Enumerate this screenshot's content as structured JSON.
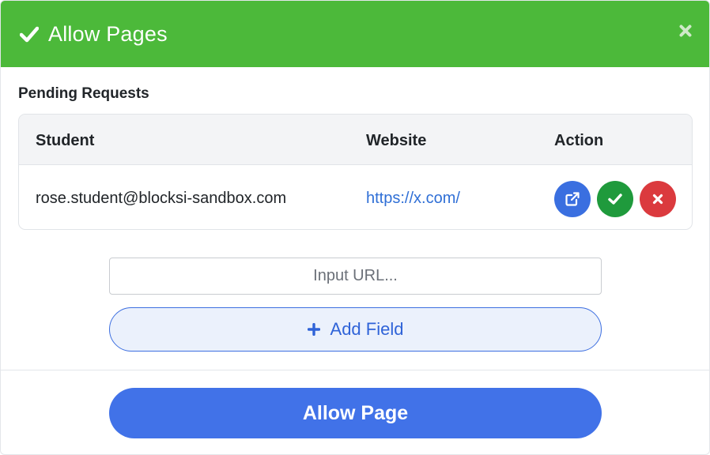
{
  "header": {
    "title": "Allow Pages",
    "icon": "check-icon",
    "close_icon": "close-icon",
    "color": "#4cb93a"
  },
  "pending": {
    "section_title": "Pending Requests",
    "columns": [
      "Student",
      "Website",
      "Action"
    ],
    "rows": [
      {
        "student": "rose.student@blocksi-sandbox.com",
        "website": "https://x.com/",
        "actions": [
          {
            "icon": "external-link-icon",
            "color": "#3a6fe0"
          },
          {
            "icon": "check-icon",
            "color": "#1f9a3c"
          },
          {
            "icon": "close-icon",
            "color": "#db3a3e"
          }
        ]
      }
    ]
  },
  "form": {
    "url_placeholder": "Input URL...",
    "url_value": "",
    "add_field_label": "Add Field",
    "allow_button_label": "Allow Page",
    "accent_color": "#4172e8"
  }
}
